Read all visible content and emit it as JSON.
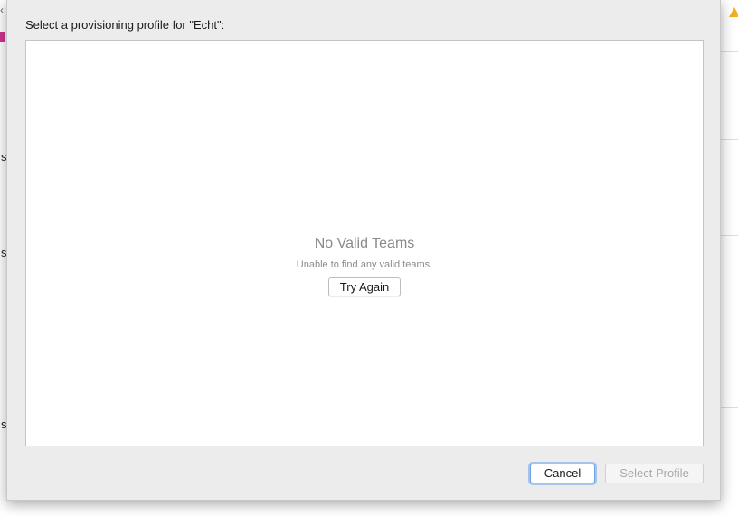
{
  "background": {
    "glyphs": [
      "s",
      "s",
      "s"
    ],
    "accent_color": "#d0338e",
    "warning_color": "#f2b01e"
  },
  "sheet": {
    "title": "Select a provisioning profile for \"Echt\":",
    "empty_state": {
      "title": "No Valid Teams",
      "subtitle": "Unable to find any valid teams.",
      "retry_label": "Try Again"
    },
    "buttons": {
      "cancel_label": "Cancel",
      "select_label": "Select Profile"
    }
  }
}
